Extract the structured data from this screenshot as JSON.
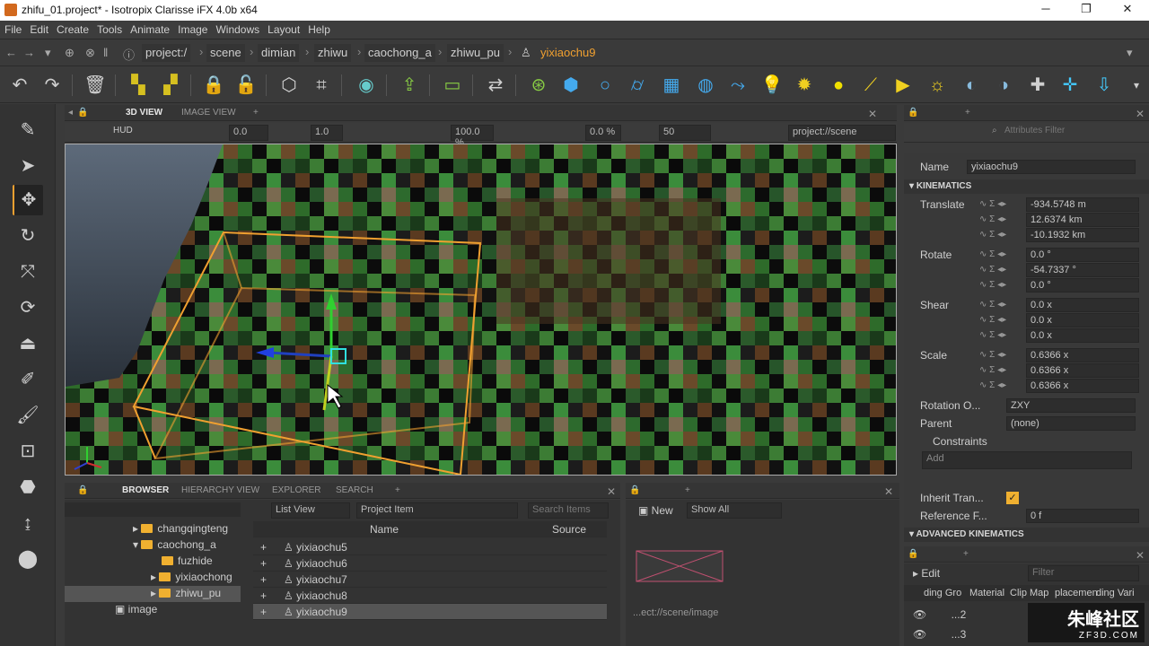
{
  "window": {
    "title": "zhifu_01.project* - Isotropix Clarisse iFX 4.0b x64",
    "minimize": "─",
    "restore": "❐",
    "close": "✕"
  },
  "menu": [
    "File",
    "Edit",
    "Create",
    "Tools",
    "Animate",
    "Image",
    "Windows",
    "Layout",
    "Help"
  ],
  "breadcrumb": [
    "project:/",
    "scene",
    "dimian",
    "zhiwu",
    "caochong_a",
    "zhiwu_pu",
    "yixiaochu9"
  ],
  "viewport": {
    "tabs": [
      "3D VIEW",
      "IMAGE VIEW"
    ],
    "hud": "HUD",
    "exposure": "0.0",
    "gamma": "1.0",
    "percent1": "100.0 %",
    "percent2": "0.0 %",
    "samples": "50",
    "context": "project://scene"
  },
  "attributes": {
    "filter_placeholder": "Attributes Filter",
    "name_label": "Name",
    "name_value": "yixiaochu9",
    "kinematics": "KINEMATICS",
    "translate_label": "Translate",
    "translate": [
      "-934.5748 m",
      "12.6374 km",
      "-10.1932 km"
    ],
    "rotate_label": "Rotate",
    "rotate": [
      "0.0 °",
      "-54.7337 °",
      "0.0 °"
    ],
    "shear_label": "Shear",
    "shear": [
      "0.0 x",
      "0.0 x",
      "0.0 x"
    ],
    "scale_label": "Scale",
    "scale": [
      "0.6366 x",
      "0.6366 x",
      "0.6366 x"
    ],
    "rotation_order_label": "Rotation O...",
    "rotation_order": "ZXY",
    "parent_label": "Parent",
    "parent": "(none)",
    "constraints_label": "Constraints",
    "add": "Add",
    "inherit_label": "Inherit Tran...",
    "reference_label": "Reference F...",
    "reference_value": "0 f",
    "advanced": "ADVANCED KINEMATICS"
  },
  "browser": {
    "tabs": [
      "BROWSER",
      "HIERARCHY VIEW",
      "EXPLORER",
      "SEARCH"
    ],
    "view_mode": "List View",
    "item_type": "Project Item",
    "search_placeholder": "Search Items",
    "col_name": "Name",
    "col_source": "Source",
    "tree": [
      "changqingteng",
      "caochong_a",
      "fuzhide",
      "yixiaochong",
      "zhiwu_pu",
      "image"
    ],
    "items": [
      "yixiaochu5",
      "yixiaochu6",
      "yixiaochu7",
      "yixiaochu8",
      "yixiaochu9"
    ]
  },
  "imagepanel": {
    "new": "New",
    "show": "Show All",
    "path": "...ect://scene/image"
  },
  "layers": {
    "edit": "Edit",
    "filter_placeholder": "Filter",
    "cols": [
      "ding Gro",
      "Material",
      "Clip Map",
      "placemen",
      "ding Vari"
    ],
    "rows": [
      "...2",
      "...3"
    ]
  },
  "watermark": {
    "brand": "朱峰社区",
    "url": "ZF3D.COM"
  }
}
